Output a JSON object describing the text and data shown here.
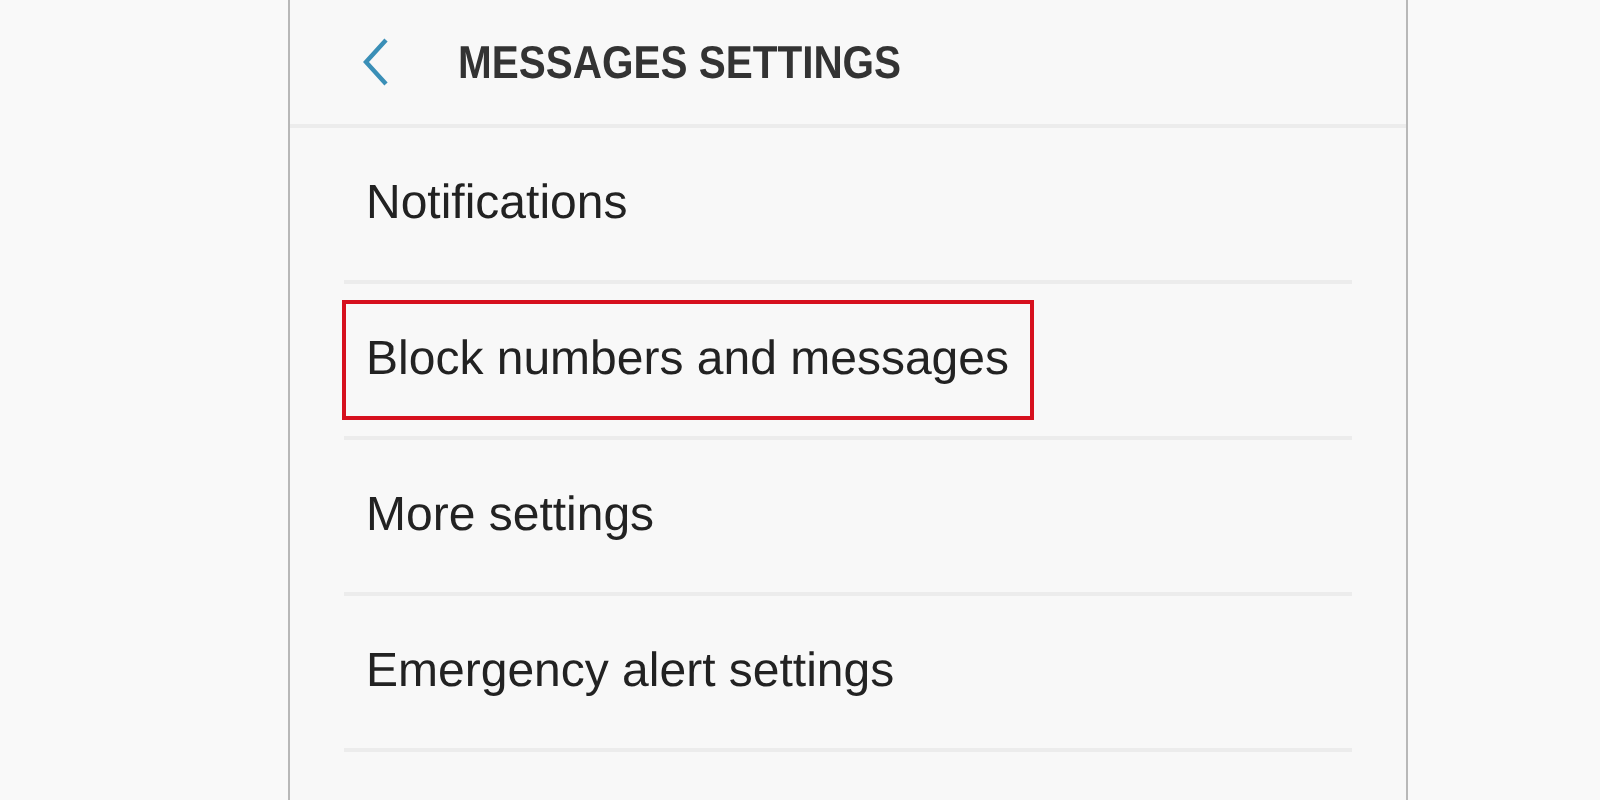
{
  "header": {
    "title": "MESSAGES SETTINGS"
  },
  "items": [
    {
      "label": "Notifications",
      "highlighted": false
    },
    {
      "label": "Block numbers and messages",
      "highlighted": true
    },
    {
      "label": "More settings",
      "highlighted": false
    },
    {
      "label": "Emergency alert settings",
      "highlighted": false
    }
  ]
}
